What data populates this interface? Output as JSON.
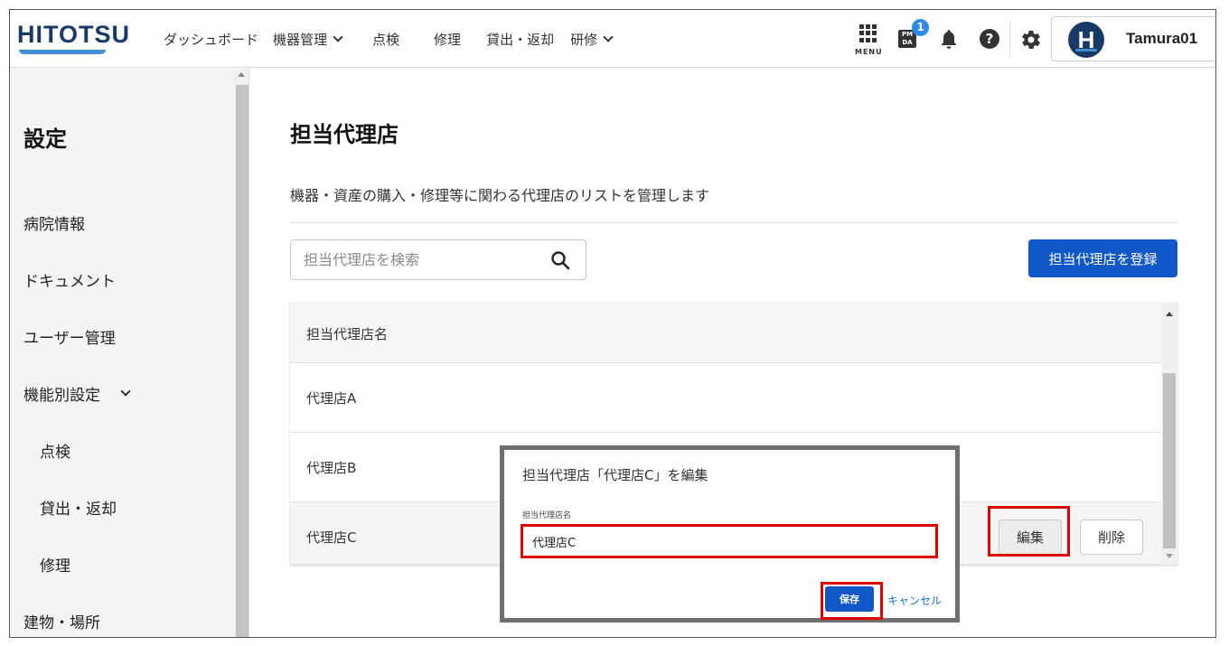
{
  "header": {
    "logo": "HITOTSU",
    "nav": [
      {
        "label": "ダッシュボード",
        "dropdown": false
      },
      {
        "label": "機器管理",
        "dropdown": true
      },
      {
        "label": "点検",
        "dropdown": false
      },
      {
        "label": "修理",
        "dropdown": false
      },
      {
        "label": "貸出・返却",
        "dropdown": false
      },
      {
        "label": "研修",
        "dropdown": true
      }
    ],
    "menu_label": "MENU",
    "pmda_label": "PM DA",
    "notification_badge": "1",
    "help_glyph": "?",
    "user": {
      "initial": "H",
      "name": "Tamura01"
    }
  },
  "sidebar": {
    "title": "設定",
    "items": [
      {
        "label": "病院情報",
        "sub": false
      },
      {
        "label": "ドキュメント",
        "sub": false
      },
      {
        "label": "ユーザー管理",
        "sub": false
      },
      {
        "label": "機能別設定",
        "sub": false,
        "expandable": true
      },
      {
        "label": "点検",
        "sub": true
      },
      {
        "label": "貸出・返却",
        "sub": true
      },
      {
        "label": "修理",
        "sub": true
      },
      {
        "label": "建物・場所",
        "sub": false
      }
    ]
  },
  "main": {
    "title": "担当代理店",
    "description": "機器・資産の購入・修理等に関わる代理店のリストを管理します",
    "search_placeholder": "担当代理店を検索",
    "register_button": "担当代理店を登録",
    "table": {
      "column_header": "担当代理店名",
      "rows": [
        "代理店A",
        "代理店B",
        "代理店C"
      ],
      "edit_label": "編集",
      "delete_label": "削除"
    }
  },
  "modal": {
    "title": "担当代理店「代理店C」を編集",
    "field_label": "担当代理店名",
    "field_value": "代理店C",
    "save_label": "保存",
    "cancel_label": "キャンセル"
  },
  "colors": {
    "primary": "#1057c8",
    "brand": "#173a66",
    "highlight": "#e00000",
    "link": "#1a6fd0"
  }
}
